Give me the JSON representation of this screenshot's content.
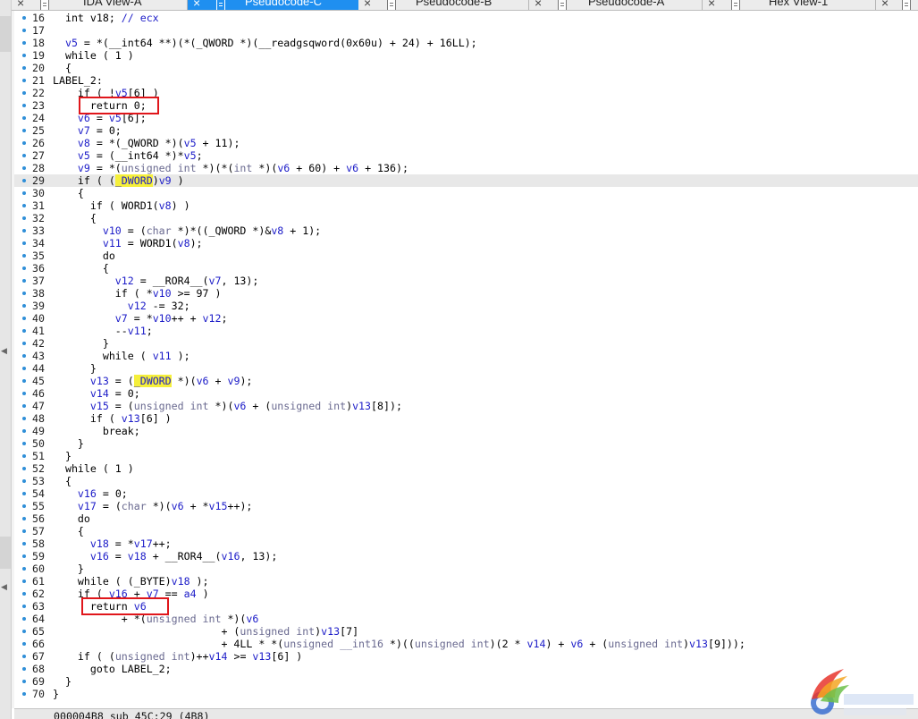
{
  "tabs": [
    {
      "label": "IDA View-A",
      "active": false
    },
    {
      "label": "Pseudocode-C",
      "active": true
    },
    {
      "label": "Pseudocode-B",
      "active": false
    },
    {
      "label": "Pseudocode-A",
      "active": false
    },
    {
      "label": "Hex View-1",
      "active": false
    }
  ],
  "code_lines": [
    {
      "num": "16",
      "tokens": [
        [
          "",
          "  int v18; "
        ],
        [
          "cmt",
          "// ecx"
        ]
      ]
    },
    {
      "num": "17",
      "tokens": []
    },
    {
      "num": "18",
      "tokens": [
        [
          "var",
          "  v5"
        ],
        [
          "",
          " = *(__int64 **)(*(_QWORD *)(__readgsqword(0x60u) + 24) + 16LL);"
        ]
      ]
    },
    {
      "num": "19",
      "tokens": [
        [
          "",
          "  while ( 1 )"
        ]
      ]
    },
    {
      "num": "20",
      "tokens": [
        [
          "",
          "  {"
        ]
      ]
    },
    {
      "num": "21",
      "tokens": [
        [
          "",
          "LABEL_2:"
        ]
      ]
    },
    {
      "num": "22",
      "tokens": [
        [
          "",
          "    if ( !"
        ],
        [
          "var",
          "v5"
        ],
        [
          "",
          "[6] )"
        ]
      ]
    },
    {
      "num": "23",
      "tokens": [
        [
          "",
          "      return 0;"
        ]
      ]
    },
    {
      "num": "24",
      "tokens": [
        [
          "var",
          "    v6"
        ],
        [
          "",
          " = "
        ],
        [
          "var",
          "v5"
        ],
        [
          "",
          "[6];"
        ]
      ]
    },
    {
      "num": "25",
      "tokens": [
        [
          "var",
          "    v7"
        ],
        [
          "",
          " = 0;"
        ]
      ]
    },
    {
      "num": "26",
      "tokens": [
        [
          "var",
          "    v8"
        ],
        [
          "",
          " = *(_QWORD *)("
        ],
        [
          "var",
          "v5"
        ],
        [
          "",
          " + 11);"
        ]
      ]
    },
    {
      "num": "27",
      "tokens": [
        [
          "var",
          "    v5"
        ],
        [
          "",
          " = (__int64 *)*"
        ],
        [
          "var",
          "v5"
        ],
        [
          "",
          ";"
        ]
      ]
    },
    {
      "num": "28",
      "tokens": [
        [
          "var",
          "    v9"
        ],
        [
          "",
          " = *("
        ],
        [
          "type",
          "unsigned int"
        ],
        [
          "",
          " *)(*("
        ],
        [
          "type",
          "int"
        ],
        [
          "",
          " *)("
        ],
        [
          "var",
          "v6"
        ],
        [
          "",
          " + 60) + "
        ],
        [
          "var",
          "v6"
        ],
        [
          "",
          " + 136);"
        ]
      ]
    },
    {
      "num": "29",
      "tokens": [
        [
          "",
          "    if ( ("
        ],
        [
          "hl",
          "_DWORD"
        ],
        [
          "",
          ")"
        ],
        [
          "var",
          "v9"
        ],
        [
          "",
          " )"
        ]
      ],
      "highlight": true
    },
    {
      "num": "30",
      "tokens": [
        [
          "",
          "    {"
        ]
      ]
    },
    {
      "num": "31",
      "tokens": [
        [
          "",
          "      if ( WORD1("
        ],
        [
          "var",
          "v8"
        ],
        [
          "",
          ") )"
        ]
      ]
    },
    {
      "num": "32",
      "tokens": [
        [
          "",
          "      {"
        ]
      ]
    },
    {
      "num": "33",
      "tokens": [
        [
          "var",
          "        v10"
        ],
        [
          "",
          " = ("
        ],
        [
          "type",
          "char"
        ],
        [
          "",
          " *)*((_QWORD *)&"
        ],
        [
          "var",
          "v8"
        ],
        [
          "",
          " + 1);"
        ]
      ]
    },
    {
      "num": "34",
      "tokens": [
        [
          "var",
          "        v11"
        ],
        [
          "",
          " = WORD1("
        ],
        [
          "var",
          "v8"
        ],
        [
          "",
          ");"
        ]
      ]
    },
    {
      "num": "35",
      "tokens": [
        [
          "",
          "        do"
        ]
      ]
    },
    {
      "num": "36",
      "tokens": [
        [
          "",
          "        {"
        ]
      ]
    },
    {
      "num": "37",
      "tokens": [
        [
          "var",
          "          v12"
        ],
        [
          "",
          " = __ROR4__("
        ],
        [
          "var",
          "v7"
        ],
        [
          "",
          ", 13);"
        ]
      ]
    },
    {
      "num": "38",
      "tokens": [
        [
          "",
          "          if ( *"
        ],
        [
          "var",
          "v10"
        ],
        [
          "",
          " >= 97 )"
        ]
      ]
    },
    {
      "num": "39",
      "tokens": [
        [
          "var",
          "            v12"
        ],
        [
          "",
          " -= 32;"
        ]
      ]
    },
    {
      "num": "40",
      "tokens": [
        [
          "var",
          "          v7"
        ],
        [
          "",
          " = *"
        ],
        [
          "var",
          "v10"
        ],
        [
          "",
          "++ + "
        ],
        [
          "var",
          "v12"
        ],
        [
          "",
          ";"
        ]
      ]
    },
    {
      "num": "41",
      "tokens": [
        [
          "",
          "          --"
        ],
        [
          "var",
          "v11"
        ],
        [
          "",
          ";"
        ]
      ]
    },
    {
      "num": "42",
      "tokens": [
        [
          "",
          "        }"
        ]
      ]
    },
    {
      "num": "43",
      "tokens": [
        [
          "",
          "        while ( "
        ],
        [
          "var",
          "v11"
        ],
        [
          "",
          " );"
        ]
      ]
    },
    {
      "num": "44",
      "tokens": [
        [
          "",
          "      }"
        ]
      ]
    },
    {
      "num": "45",
      "tokens": [
        [
          "var",
          "      v13"
        ],
        [
          "",
          " = ("
        ],
        [
          "hl",
          "_DWORD"
        ],
        [
          "",
          " *)("
        ],
        [
          "var",
          "v6"
        ],
        [
          "",
          " + "
        ],
        [
          "var",
          "v9"
        ],
        [
          "",
          ");"
        ]
      ]
    },
    {
      "num": "46",
      "tokens": [
        [
          "var",
          "      v14"
        ],
        [
          "",
          " = 0;"
        ]
      ]
    },
    {
      "num": "47",
      "tokens": [
        [
          "var",
          "      v15"
        ],
        [
          "",
          " = ("
        ],
        [
          "type",
          "unsigned int"
        ],
        [
          "",
          " *)("
        ],
        [
          "var",
          "v6"
        ],
        [
          "",
          " + ("
        ],
        [
          "type",
          "unsigned int"
        ],
        [
          "",
          ")"
        ],
        [
          "var",
          "v13"
        ],
        [
          "",
          "[8]);"
        ]
      ]
    },
    {
      "num": "48",
      "tokens": [
        [
          "",
          "      if ( "
        ],
        [
          "var",
          "v13"
        ],
        [
          "",
          "[6] )"
        ]
      ]
    },
    {
      "num": "49",
      "tokens": [
        [
          "",
          "        break;"
        ]
      ]
    },
    {
      "num": "50",
      "tokens": [
        [
          "",
          "    }"
        ]
      ]
    },
    {
      "num": "51",
      "tokens": [
        [
          "",
          "  }"
        ]
      ]
    },
    {
      "num": "52",
      "tokens": [
        [
          "",
          "  while ( 1 )"
        ]
      ]
    },
    {
      "num": "53",
      "tokens": [
        [
          "",
          "  {"
        ]
      ]
    },
    {
      "num": "54",
      "tokens": [
        [
          "var",
          "    v16"
        ],
        [
          "",
          " = 0;"
        ]
      ]
    },
    {
      "num": "55",
      "tokens": [
        [
          "var",
          "    v17"
        ],
        [
          "",
          " = ("
        ],
        [
          "type",
          "char"
        ],
        [
          "",
          " *)("
        ],
        [
          "var",
          "v6"
        ],
        [
          "",
          " + *"
        ],
        [
          "var",
          "v15"
        ],
        [
          "",
          "++);"
        ]
      ]
    },
    {
      "num": "56",
      "tokens": [
        [
          "",
          "    do"
        ]
      ]
    },
    {
      "num": "57",
      "tokens": [
        [
          "",
          "    {"
        ]
      ]
    },
    {
      "num": "58",
      "tokens": [
        [
          "var",
          "      v18"
        ],
        [
          "",
          " = *"
        ],
        [
          "var",
          "v17"
        ],
        [
          "",
          "++;"
        ]
      ]
    },
    {
      "num": "59",
      "tokens": [
        [
          "var",
          "      v16"
        ],
        [
          "",
          " = "
        ],
        [
          "var",
          "v18"
        ],
        [
          "",
          " + __ROR4__("
        ],
        [
          "var",
          "v16"
        ],
        [
          "",
          ", 13);"
        ]
      ]
    },
    {
      "num": "60",
      "tokens": [
        [
          "",
          "    }"
        ]
      ]
    },
    {
      "num": "61",
      "tokens": [
        [
          "",
          "    while ( (_BYTE)"
        ],
        [
          "var",
          "v18"
        ],
        [
          "",
          " );"
        ]
      ]
    },
    {
      "num": "62",
      "tokens": [
        [
          "",
          "    if ( "
        ],
        [
          "var",
          "v16"
        ],
        [
          "",
          " + "
        ],
        [
          "var",
          "v7"
        ],
        [
          "",
          " == "
        ],
        [
          "var",
          "a4"
        ],
        [
          "",
          " )"
        ]
      ]
    },
    {
      "num": "63",
      "tokens": [
        [
          "",
          "      return "
        ],
        [
          "var",
          "v6"
        ]
      ]
    },
    {
      "num": "64",
      "tokens": [
        [
          "",
          "           + *("
        ],
        [
          "type",
          "unsigned int"
        ],
        [
          "",
          " *)("
        ],
        [
          "var",
          "v6"
        ]
      ]
    },
    {
      "num": "65",
      "tokens": [
        [
          "",
          "                           + ("
        ],
        [
          "type",
          "unsigned int"
        ],
        [
          "",
          ")"
        ],
        [
          "var",
          "v13"
        ],
        [
          "",
          "[7]"
        ]
      ]
    },
    {
      "num": "66",
      "tokens": [
        [
          "",
          "                           + 4LL * *("
        ],
        [
          "type",
          "unsigned __int16"
        ],
        [
          "",
          " *)(("
        ],
        [
          "type",
          "unsigned int"
        ],
        [
          "",
          ")(2 * "
        ],
        [
          "var",
          "v14"
        ],
        [
          "",
          ") + "
        ],
        [
          "var",
          "v6"
        ],
        [
          "",
          " + ("
        ],
        [
          "type",
          "unsigned int"
        ],
        [
          "",
          ")"
        ],
        [
          "var",
          "v13"
        ],
        [
          "",
          "[9]));"
        ]
      ]
    },
    {
      "num": "67",
      "tokens": [
        [
          "",
          "    if ( ("
        ],
        [
          "type",
          "unsigned int"
        ],
        [
          "",
          ")++"
        ],
        [
          "var",
          "v14"
        ],
        [
          "",
          " >= "
        ],
        [
          "var",
          "v13"
        ],
        [
          "",
          "[6] )"
        ]
      ]
    },
    {
      "num": "68",
      "tokens": [
        [
          "",
          "      goto LABEL_2;"
        ]
      ]
    },
    {
      "num": "69",
      "tokens": [
        [
          "",
          "  }"
        ]
      ]
    },
    {
      "num": "70",
      "tokens": [
        [
          "",
          "}"
        ]
      ]
    }
  ],
  "status_bar": "000004B8 sub_45C:29 (4B8)",
  "colors": {
    "tab_active": "#1f8ff0",
    "variable": "#1c1cc8",
    "type": "#6a6a90",
    "highlight_word": "#f5ef3b",
    "annotation_box": "#e0161b",
    "line_dot": "#2f8fd8"
  }
}
